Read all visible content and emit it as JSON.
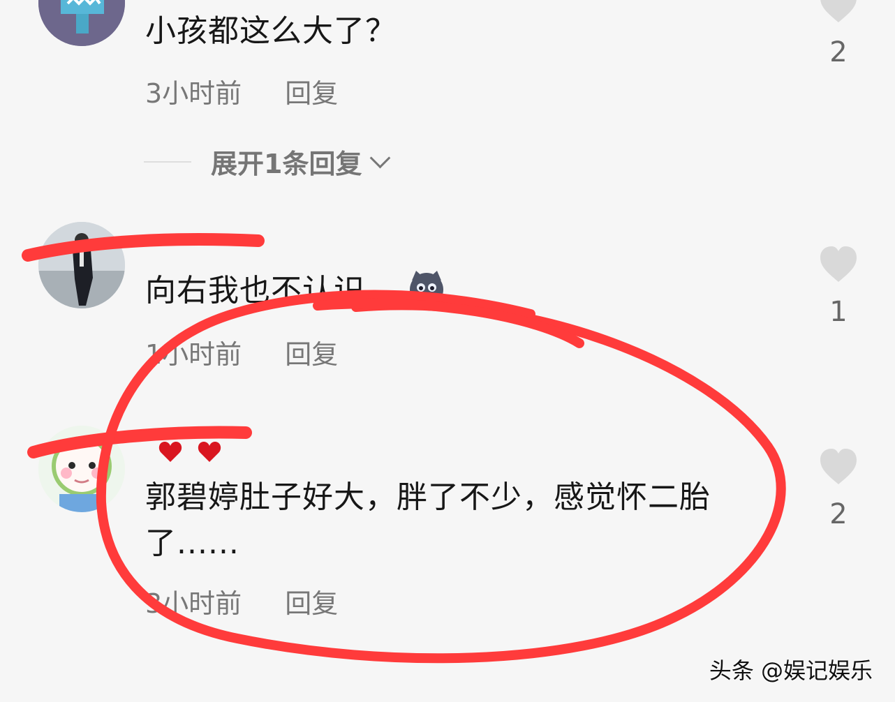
{
  "comments": [
    {
      "text": "小孩都这么大了？",
      "time": "3小时前",
      "reply_label": "回复",
      "likes": "2",
      "expand_label": "展开1条回复"
    },
    {
      "text": "向右我也不认识",
      "time": "1小时前",
      "reply_label": "回复",
      "likes": "1"
    },
    {
      "text": "郭碧婷肚子好大，胖了不少，感觉怀二胎了......",
      "time": "3小时前",
      "reply_label": "回复",
      "likes": "2"
    }
  ],
  "watermark": "头条 @娱记娱乐",
  "colors": {
    "annotation_red": "#ff3b3b",
    "heart_gray": "#d8d8d8",
    "meta_gray": "#777777"
  },
  "icons": {
    "like": "heart-outline-icon",
    "expand": "chevron-down-icon",
    "emoji": "cat-emoji-icon"
  }
}
